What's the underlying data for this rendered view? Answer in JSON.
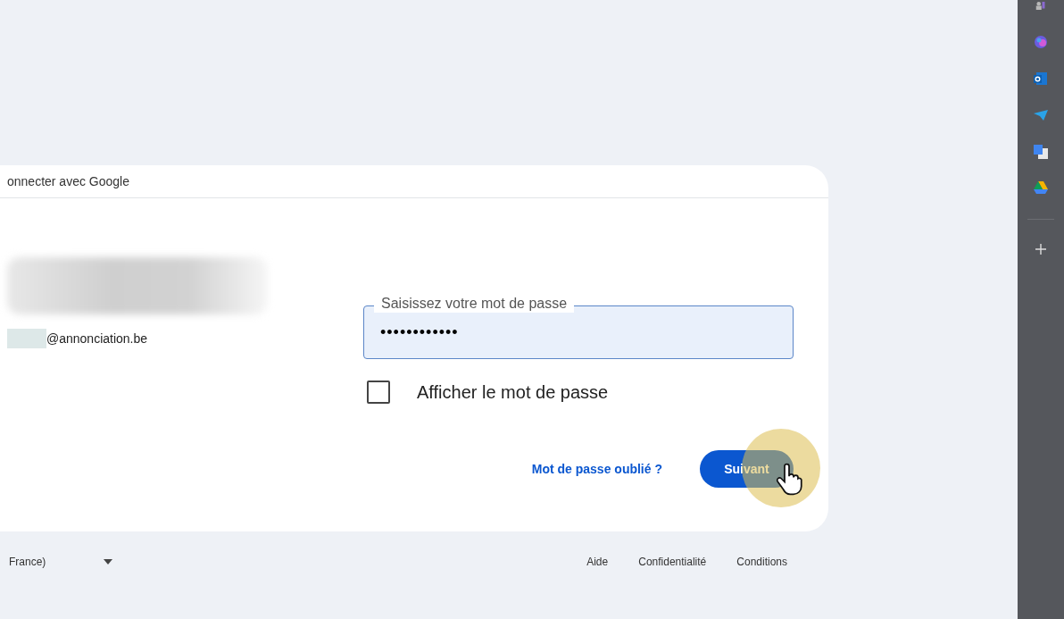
{
  "card": {
    "title": "onnecter avec Google",
    "account": {
      "email": "@annonciation.be"
    },
    "password": {
      "label": "Saisissez votre mot de passe",
      "value": "••••••••••••"
    },
    "show_password": {
      "label": "Afficher le mot de passe",
      "checked": false
    },
    "forgot_link": "Mot de passe oublié ?",
    "next_button": "Suivant"
  },
  "footer": {
    "language": "France)",
    "links": [
      "Aide",
      "Confidentialité",
      "Conditions"
    ]
  },
  "sidebar": {
    "items": [
      {
        "kind": "people"
      },
      {
        "kind": "copilot"
      },
      {
        "kind": "outlook"
      },
      {
        "kind": "telegram"
      },
      {
        "kind": "translate"
      },
      {
        "kind": "drive"
      },
      {
        "kind": "add"
      }
    ]
  }
}
